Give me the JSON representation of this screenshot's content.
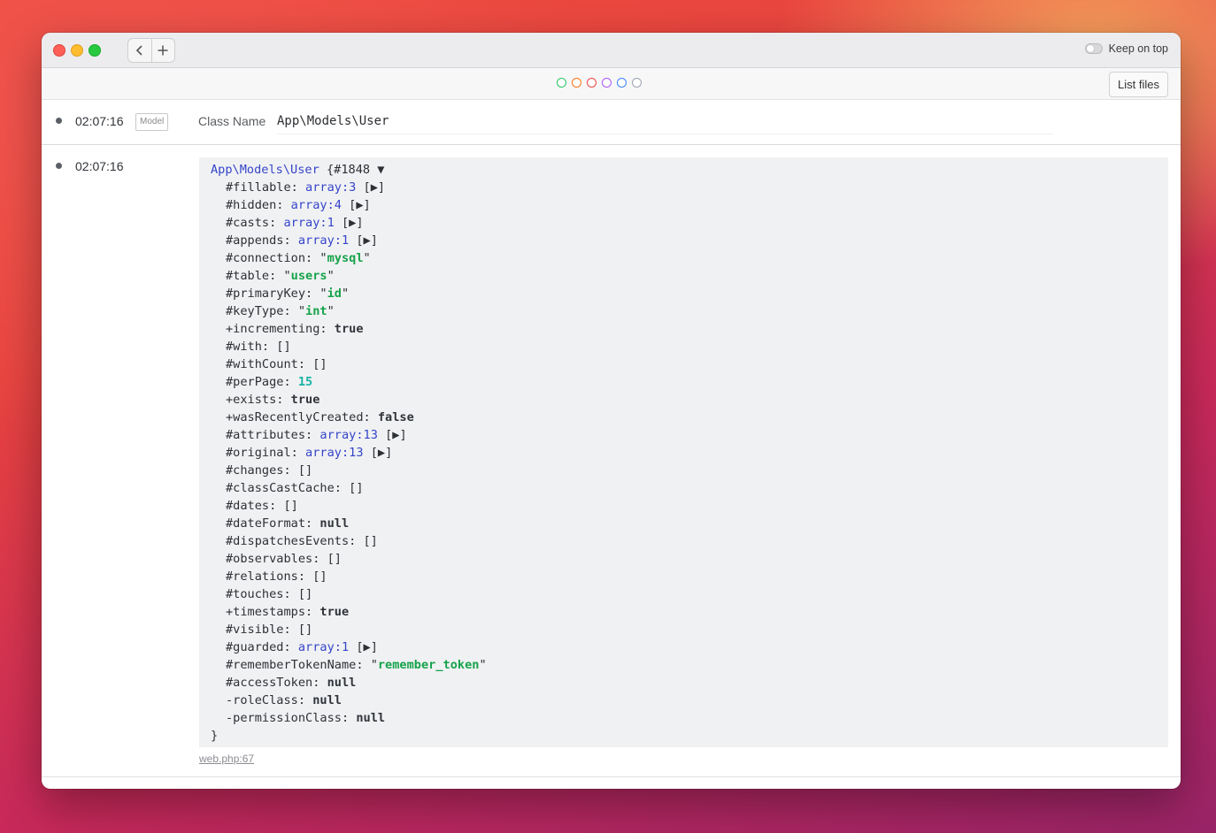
{
  "window": {
    "keep_on_top_label": "Keep on top",
    "nav": {
      "back_glyph": "‹",
      "add_glyph": "+"
    }
  },
  "toolbar": {
    "color_filters": [
      "#22c55e",
      "#f97316",
      "#ef4444",
      "#a855f7",
      "#3b82f6",
      "#9ca3af"
    ],
    "list_files_label": "List files"
  },
  "entries": [
    {
      "time": "02:07:16",
      "badge": "Model",
      "class_name_label": "Class Name",
      "class_name_value": "App\\Models\\User"
    },
    {
      "time": "02:07:16",
      "dump": {
        "class": "App\\Models\\User",
        "id": "{#1848",
        "toggle": "▼",
        "closing": "}",
        "properties": [
          {
            "key": "#fillable: ",
            "type": "array",
            "value": "array:3",
            "expand": " [▶]"
          },
          {
            "key": "#hidden: ",
            "type": "array",
            "value": "array:4",
            "expand": " [▶]"
          },
          {
            "key": "#casts: ",
            "type": "array",
            "value": "array:1",
            "expand": " [▶]"
          },
          {
            "key": "#appends: ",
            "type": "array",
            "value": "array:1",
            "expand": " [▶]"
          },
          {
            "key": "#connection: ",
            "type": "string",
            "value": "mysql"
          },
          {
            "key": "#table: ",
            "type": "string",
            "value": "users"
          },
          {
            "key": "#primaryKey: ",
            "type": "string",
            "value": "id"
          },
          {
            "key": "#keyType: ",
            "type": "string",
            "value": "int"
          },
          {
            "key": "+incrementing: ",
            "type": "keyword",
            "value": "true"
          },
          {
            "key": "#with: ",
            "type": "plain",
            "value": "[]"
          },
          {
            "key": "#withCount: ",
            "type": "plain",
            "value": "[]"
          },
          {
            "key": "#perPage: ",
            "type": "number",
            "value": "15"
          },
          {
            "key": "+exists: ",
            "type": "keyword",
            "value": "true"
          },
          {
            "key": "+wasRecentlyCreated: ",
            "type": "keyword",
            "value": "false"
          },
          {
            "key": "#attributes: ",
            "type": "array",
            "value": "array:13",
            "expand": " [▶]"
          },
          {
            "key": "#original: ",
            "type": "array",
            "value": "array:13",
            "expand": " [▶]"
          },
          {
            "key": "#changes: ",
            "type": "plain",
            "value": "[]"
          },
          {
            "key": "#classCastCache: ",
            "type": "plain",
            "value": "[]"
          },
          {
            "key": "#dates: ",
            "type": "plain",
            "value": "[]"
          },
          {
            "key": "#dateFormat: ",
            "type": "keyword",
            "value": "null"
          },
          {
            "key": "#dispatchesEvents: ",
            "type": "plain",
            "value": "[]"
          },
          {
            "key": "#observables: ",
            "type": "plain",
            "value": "[]"
          },
          {
            "key": "#relations: ",
            "type": "plain",
            "value": "[]"
          },
          {
            "key": "#touches: ",
            "type": "plain",
            "value": "[]"
          },
          {
            "key": "+timestamps: ",
            "type": "keyword",
            "value": "true"
          },
          {
            "key": "#visible: ",
            "type": "plain",
            "value": "[]"
          },
          {
            "key": "#guarded: ",
            "type": "array",
            "value": "array:1",
            "expand": " [▶]"
          },
          {
            "key": "#rememberTokenName: ",
            "type": "string",
            "value": "remember_token"
          },
          {
            "key": "#accessToken: ",
            "type": "keyword",
            "value": "null"
          },
          {
            "key": "-roleClass: ",
            "type": "keyword",
            "value": "null"
          },
          {
            "key": "-permissionClass: ",
            "type": "keyword",
            "value": "null"
          }
        ]
      },
      "file_link": "web.php:67"
    }
  ]
}
